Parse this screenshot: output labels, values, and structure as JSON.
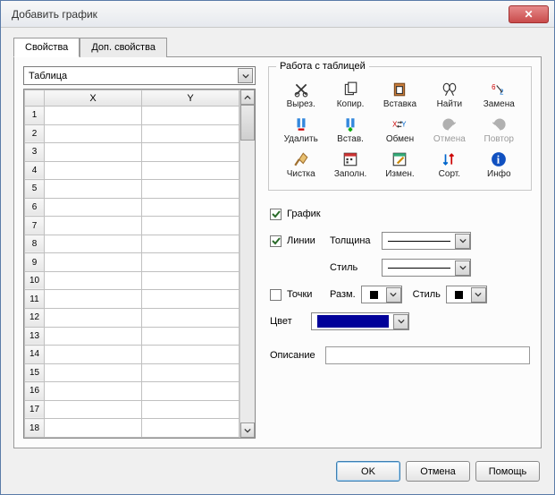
{
  "window": {
    "title": "Добавить график"
  },
  "tabs": [
    {
      "label": "Свойства",
      "active": true
    },
    {
      "label": "Доп. свойства",
      "active": false
    }
  ],
  "source_dropdown": {
    "value": "Таблица"
  },
  "table": {
    "headers": {
      "x": "X",
      "y": "Y"
    },
    "row_count": 18
  },
  "toolbox": {
    "title": "Работа с таблицей",
    "rows": [
      [
        {
          "id": "cut",
          "label": "Вырез.",
          "enabled": true
        },
        {
          "id": "copy",
          "label": "Копир.",
          "enabled": true
        },
        {
          "id": "paste",
          "label": "Вставка",
          "enabled": true
        },
        {
          "id": "find",
          "label": "Найти",
          "enabled": true
        },
        {
          "id": "replace",
          "label": "Замена",
          "enabled": true
        }
      ],
      [
        {
          "id": "delete",
          "label": "Удалить",
          "enabled": true
        },
        {
          "id": "insert",
          "label": "Встав.",
          "enabled": true
        },
        {
          "id": "swap",
          "label": "Обмен",
          "enabled": true
        },
        {
          "id": "undo",
          "label": "Отмена",
          "enabled": false
        },
        {
          "id": "redo",
          "label": "Повтор",
          "enabled": false
        }
      ],
      [
        {
          "id": "clean",
          "label": "Чистка",
          "enabled": true
        },
        {
          "id": "fill",
          "label": "Заполн.",
          "enabled": true
        },
        {
          "id": "modify",
          "label": "Измен.",
          "enabled": true
        },
        {
          "id": "sort",
          "label": "Сорт.",
          "enabled": true
        },
        {
          "id": "info",
          "label": "Инфо",
          "enabled": true
        }
      ]
    ]
  },
  "style": {
    "graph": {
      "label": "График",
      "checked": true
    },
    "lines": {
      "label": "Линии",
      "checked": true
    },
    "thickness_label": "Толщина",
    "linestyle_label": "Стиль",
    "points": {
      "label": "Точки",
      "checked": false
    },
    "pointsize_label": "Разм.",
    "pointstyle_label": "Стиль",
    "color_label": "Цвет",
    "color_value": "#000099",
    "description_label": "Описание",
    "description_value": ""
  },
  "buttons": {
    "ok": "OK",
    "cancel": "Отмена",
    "help": "Помощь"
  }
}
